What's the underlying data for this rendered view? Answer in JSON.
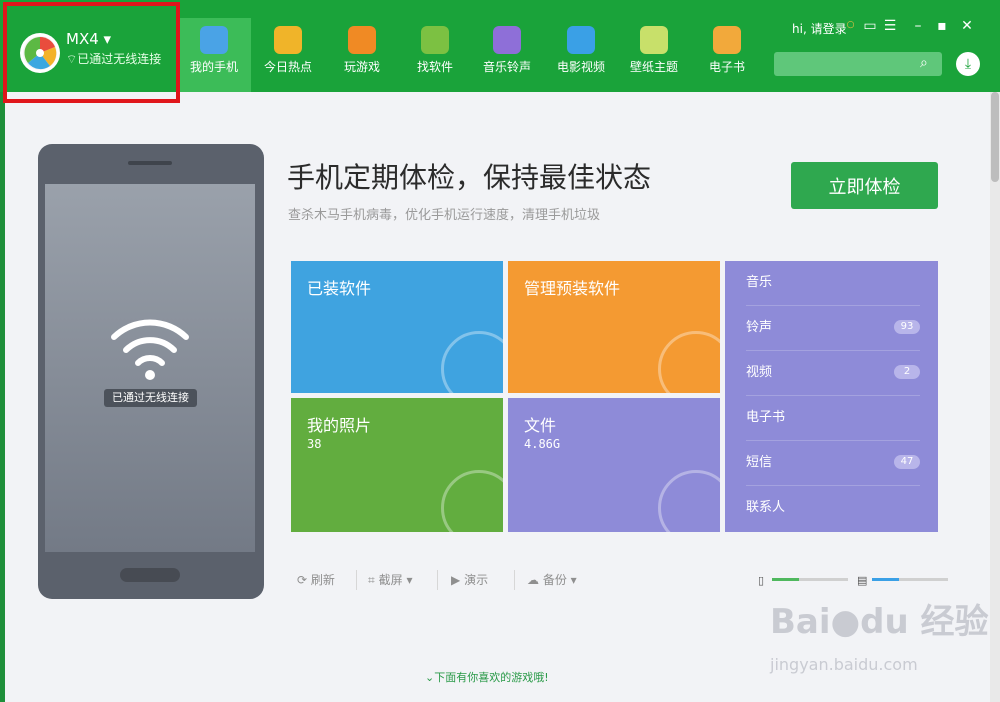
{
  "device": {
    "name": "MX4",
    "status": "已通过无线连接"
  },
  "nav": [
    {
      "label": "我的手机",
      "icon": "phone-icon",
      "color": "#4aa3e6",
      "active": true
    },
    {
      "label": "今日热点",
      "icon": "star-icon",
      "color": "#f0b429"
    },
    {
      "label": "玩游戏",
      "icon": "gamepad-icon",
      "color": "#f08a24"
    },
    {
      "label": "找软件",
      "icon": "android-icon",
      "color": "#7cc142"
    },
    {
      "label": "音乐铃声",
      "icon": "music-icon",
      "color": "#8e6fd8"
    },
    {
      "label": "电影视频",
      "icon": "play-icon",
      "color": "#3aa0e6"
    },
    {
      "label": "壁纸主题",
      "icon": "wallpaper-icon",
      "color": "#c8e06a"
    },
    {
      "label": "电子书",
      "icon": "book-icon",
      "color": "#f2a93b"
    }
  ],
  "topright": {
    "greeting": "hi, 请登录"
  },
  "phone": {
    "wifi_label": "已通过无线连接"
  },
  "main": {
    "headline": "手机定期体检，保持最佳状态",
    "subline": "查杀木马手机病毒，优化手机运行速度，清理手机垃圾",
    "check_button": "立即体检"
  },
  "tiles": {
    "installed": {
      "title": "已装软件",
      "color": "#3fa3e0"
    },
    "preinstalled": {
      "title": "管理预装软件",
      "color": "#f49a32"
    },
    "photos": {
      "title": "我的照片",
      "value": "38",
      "color": "#62ad3f"
    },
    "files": {
      "title": "文件",
      "value": "4.86G",
      "color": "#8e8bd8"
    }
  },
  "side": [
    {
      "label": "音乐",
      "badge": ""
    },
    {
      "label": "铃声",
      "badge": "93"
    },
    {
      "label": "视频",
      "badge": "2"
    },
    {
      "label": "电子书",
      "badge": ""
    },
    {
      "label": "短信",
      "badge": "47"
    },
    {
      "label": "联系人",
      "badge": ""
    }
  ],
  "toolbar": {
    "refresh": "刷新",
    "screenshot": "截屏",
    "demo": "演示",
    "backup": "备份"
  },
  "storage": {
    "phone_fraction": 0.35,
    "sd_fraction": 0.35
  },
  "promo": "下面有你喜欢的游戏哦!",
  "watermark": {
    "brand": "Bai●du 经验",
    "url": "jingyan.baidu.com"
  }
}
